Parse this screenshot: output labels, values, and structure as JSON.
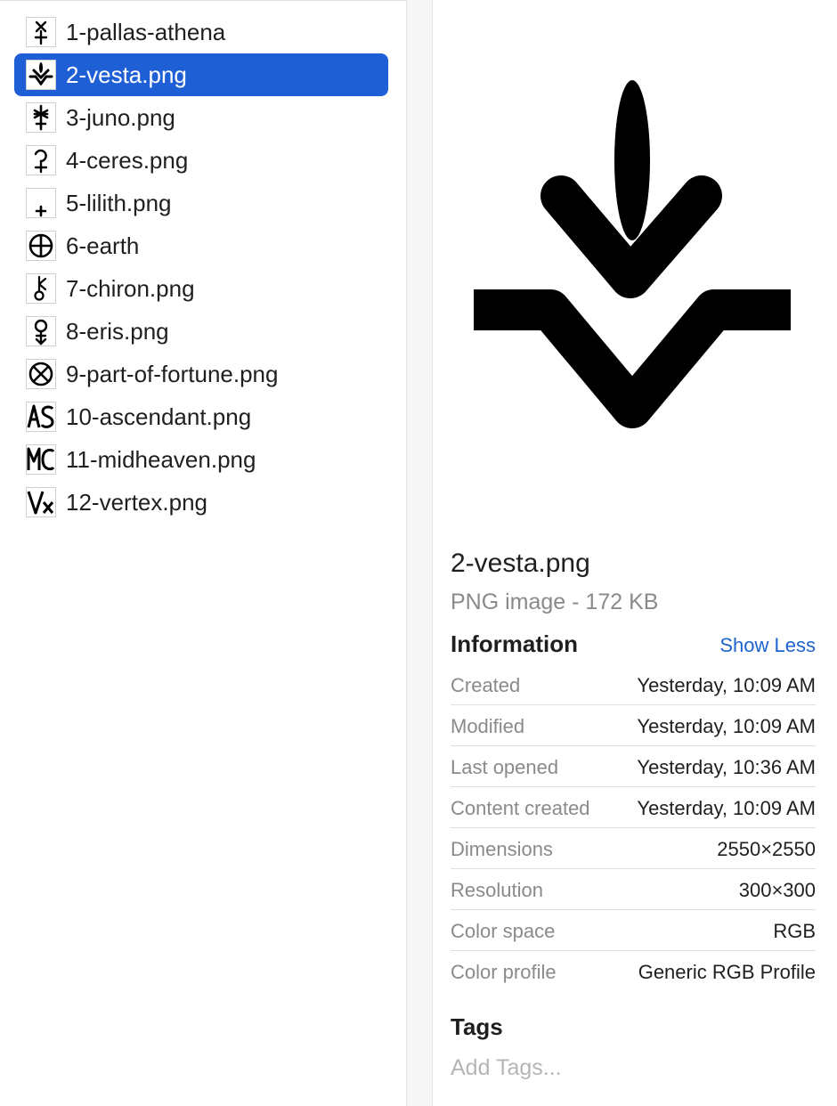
{
  "files": [
    {
      "name": "1-pallas-athena",
      "icon": "pallas-athena-glyph-icon",
      "selected": false
    },
    {
      "name": "2-vesta.png",
      "icon": "vesta-glyph-icon",
      "selected": true
    },
    {
      "name": "3-juno.png",
      "icon": "juno-glyph-icon",
      "selected": false
    },
    {
      "name": "4-ceres.png",
      "icon": "ceres-glyph-icon",
      "selected": false
    },
    {
      "name": "5-lilith.png",
      "icon": "lilith-glyph-icon",
      "selected": false
    },
    {
      "name": "6-earth",
      "icon": "earth-glyph-icon",
      "selected": false
    },
    {
      "name": "7-chiron.png",
      "icon": "chiron-glyph-icon",
      "selected": false
    },
    {
      "name": "8-eris.png",
      "icon": "eris-glyph-icon",
      "selected": false
    },
    {
      "name": "9-part-of-fortune.png",
      "icon": "part-of-fortune-glyph-icon",
      "selected": false
    },
    {
      "name": "10-ascendant.png",
      "icon": "ascendant-glyph-icon",
      "selected": false
    },
    {
      "name": "11-midheaven.png",
      "icon": "midheaven-glyph-icon",
      "selected": false
    },
    {
      "name": "12-vertex.png",
      "icon": "vertex-glyph-icon",
      "selected": false
    }
  ],
  "preview": {
    "title": "2-vesta.png",
    "kind": "PNG image - 172 KB",
    "image_icon": "vesta-glyph-preview"
  },
  "information": {
    "title": "Information",
    "toggle_label": "Show Less",
    "rows": [
      {
        "label": "Created",
        "value": "Yesterday, 10:09 AM"
      },
      {
        "label": "Modified",
        "value": "Yesterday, 10:09 AM"
      },
      {
        "label": "Last opened",
        "value": "Yesterday, 10:36 AM"
      },
      {
        "label": "Content created",
        "value": "Yesterday, 10:09 AM"
      },
      {
        "label": "Dimensions",
        "value": "2550×2550"
      },
      {
        "label": "Resolution",
        "value": "300×300"
      },
      {
        "label": "Color space",
        "value": "RGB"
      },
      {
        "label": "Color profile",
        "value": "Generic RGB Profile"
      }
    ]
  },
  "tags": {
    "title": "Tags",
    "placeholder": "Add Tags..."
  },
  "colors": {
    "selection": "#1f5fd6",
    "link": "#1e63d0",
    "secondary_text": "#8a8a8a"
  }
}
